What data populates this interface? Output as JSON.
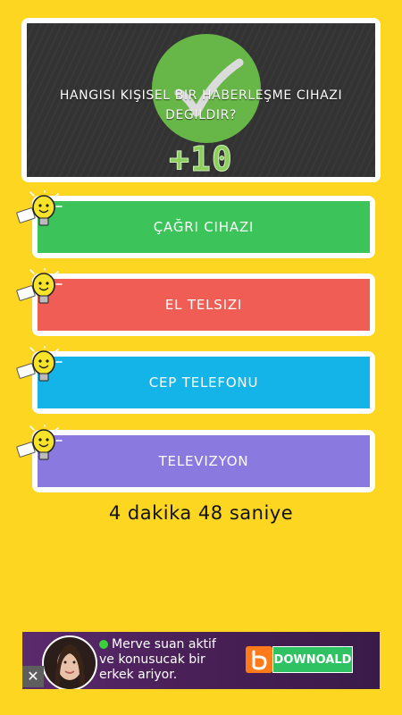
{
  "question": {
    "text": "HANGISI KIŞISEL BIR HABERLEŞME CIHAZI DEGILDIR?",
    "bonus": "+10",
    "check_icon": "checkmark-icon"
  },
  "options": [
    {
      "label": "ÇAĞRI CIHAZI",
      "color": "#3cc45a"
    },
    {
      "label": "EL TELSIZI",
      "color": "#ef5d55"
    },
    {
      "label": "CEP TELEFONU",
      "color": "#14b4e8"
    },
    {
      "label": "TELEVIZYON",
      "color": "#8a7ae0"
    }
  ],
  "hint_icon": "lightbulb-hint-icon",
  "timer": "4 dakika 48 saniye",
  "ad": {
    "line1": "Merve suan aktif",
    "line2": "ve konusucak bir",
    "line3": "erkek ariyor.",
    "button": "DOWNOALD",
    "close": "✕"
  },
  "colors": {
    "background": "#fdd622",
    "board": "#323332",
    "bonus": "#8ccf5d"
  }
}
